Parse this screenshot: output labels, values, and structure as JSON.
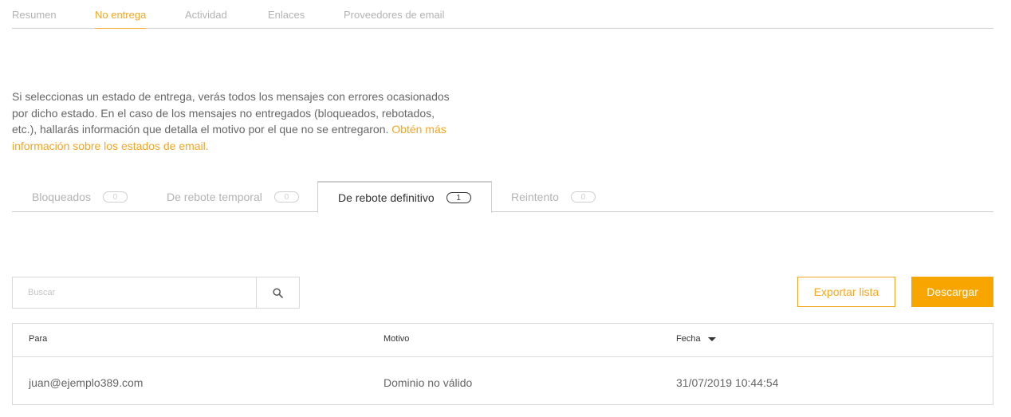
{
  "top_tabs": [
    {
      "label": "Resumen",
      "active": false
    },
    {
      "label": "No entrega",
      "active": true
    },
    {
      "label": "Actividad",
      "active": false
    },
    {
      "label": "Enlaces",
      "active": false
    },
    {
      "label": "Proveedores de email",
      "active": false
    }
  ],
  "intro": {
    "text": "Si seleccionas un estado de entrega, verás todos los mensajes con errores ocasionados por dicho estado. En el caso de los mensajes no entregados (bloqueados, rebotados, etc.), hallarás información que detalla el motivo por el que no se entregaron.",
    "link_text": "Obtén más información sobre los estados de email."
  },
  "status_tabs": [
    {
      "label": "Bloqueados",
      "count": "0",
      "active": false
    },
    {
      "label": "De rebote temporal",
      "count": "0",
      "active": false
    },
    {
      "label": "De rebote definitivo",
      "count": "1",
      "active": true
    },
    {
      "label": "Reintento",
      "count": "0",
      "active": false
    }
  ],
  "search": {
    "placeholder": "Buscar",
    "icon": "search-icon"
  },
  "buttons": {
    "export_label": "Exportar lista",
    "download_label": "Descargar"
  },
  "table": {
    "headers": {
      "para": "Para",
      "motivo": "Motivo",
      "fecha": "Fecha"
    },
    "sort": {
      "column": "fecha",
      "direction": "desc"
    },
    "rows": [
      {
        "para": "juan@ejemplo389.com",
        "motivo": "Dominio no válido",
        "fecha": "31/07/2019 10:44:54"
      }
    ]
  },
  "colors": {
    "accent": "#f5a623",
    "button_fill": "#f8a500",
    "border": "#d9d9d9"
  }
}
